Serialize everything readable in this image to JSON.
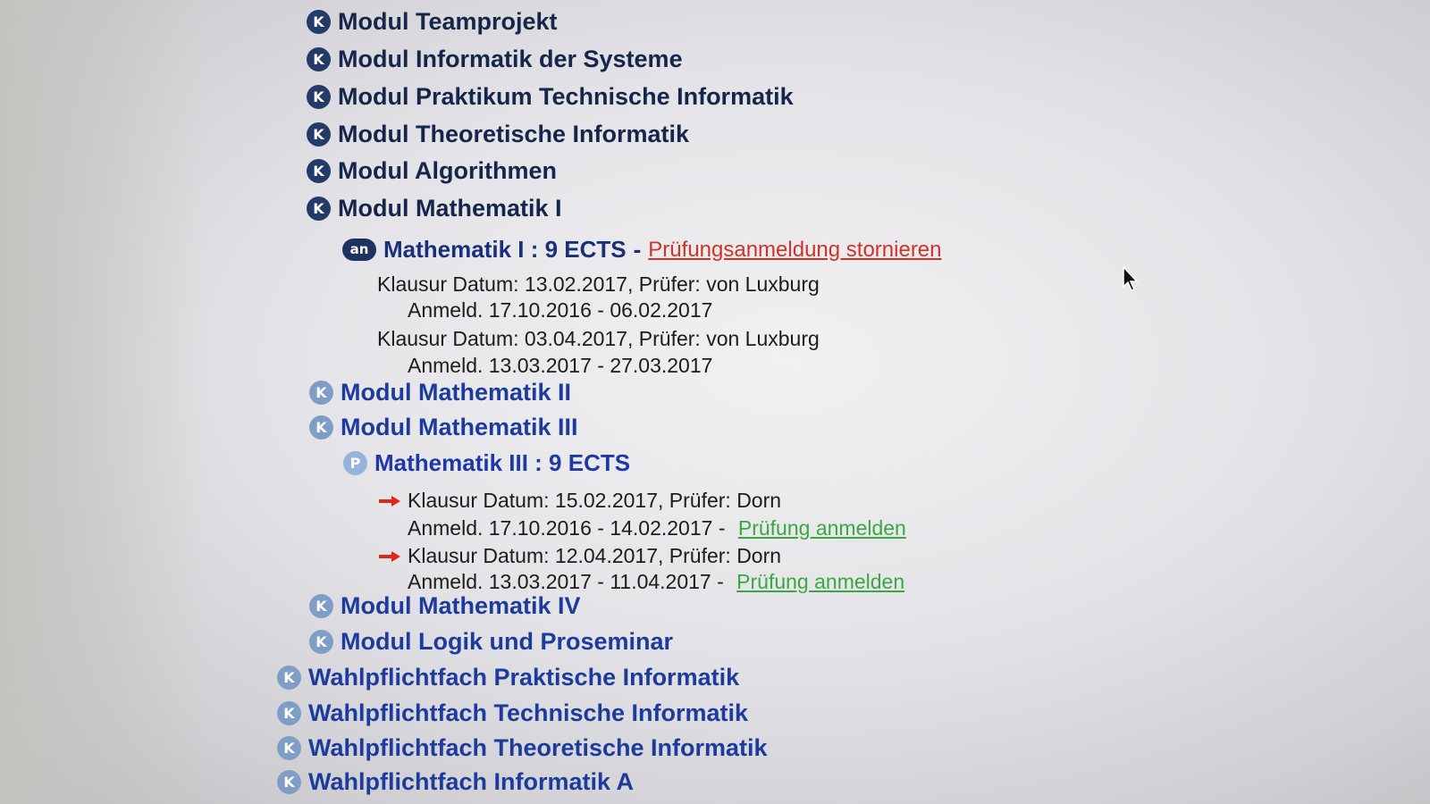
{
  "modules_top": [
    {
      "icon": "K",
      "label": "Modul Teamprojekt"
    },
    {
      "icon": "K",
      "label": "Modul Informatik der Systeme"
    },
    {
      "icon": "K",
      "label": "Modul Praktikum Technische Informatik"
    },
    {
      "icon": "K",
      "label": "Modul Theoretische Informatik"
    },
    {
      "icon": "K",
      "label": "Modul Algorithmen"
    },
    {
      "icon": "K",
      "label": "Modul Mathematik I"
    }
  ],
  "math1": {
    "icon": "an",
    "label": "Mathematik I : 9 ECTS",
    "separator": "-",
    "cancel_link": "Prüfungsanmeldung stornieren",
    "exams": [
      {
        "exam": "Klausur Datum: 13.02.2017, Prüfer: von Luxburg",
        "registration": "Anmeld. 17.10.2016 - 06.02.2017"
      },
      {
        "exam": "Klausur Datum: 03.04.2017, Prüfer: von Luxburg",
        "registration": "Anmeld. 13.03.2017 - 27.03.2017"
      }
    ]
  },
  "modules_mid": [
    {
      "icon": "K",
      "label": "Modul Mathematik II"
    },
    {
      "icon": "K",
      "label": "Modul Mathematik III"
    }
  ],
  "math3": {
    "icon": "P",
    "label": "Mathematik III : 9 ECTS",
    "exams": [
      {
        "exam": "Klausur Datum: 15.02.2017, Prüfer: Dorn",
        "registration": "Anmeld. 17.10.2016 - 14.02.2017 -",
        "link": "Prüfung anmelden"
      },
      {
        "exam": "Klausur Datum: 12.04.2017, Prüfer: Dorn",
        "registration": "Anmeld. 13.03.2017 - 11.04.2017 -",
        "link": "Prüfung anmelden"
      }
    ]
  },
  "modules_bottom": [
    {
      "icon": "K",
      "label": "Modul Mathematik IV"
    },
    {
      "icon": "K",
      "label": "Modul Logik und Proseminar"
    }
  ],
  "electives": [
    {
      "icon": "K",
      "label": "Wahlpflichtfach Praktische Informatik"
    },
    {
      "icon": "K",
      "label": "Wahlpflichtfach Technische Informatik"
    },
    {
      "icon": "K",
      "label": "Wahlpflichtfach Theoretische Informatik"
    },
    {
      "icon": "K",
      "label": "Wahlpflichtfach Informatik A"
    }
  ],
  "colors": {
    "dark_module": "#16254a",
    "blue_module": "#1d3b9c",
    "cancel_link": "#d0322a",
    "register_link": "#3aa841",
    "arrow": "#e0261a"
  }
}
